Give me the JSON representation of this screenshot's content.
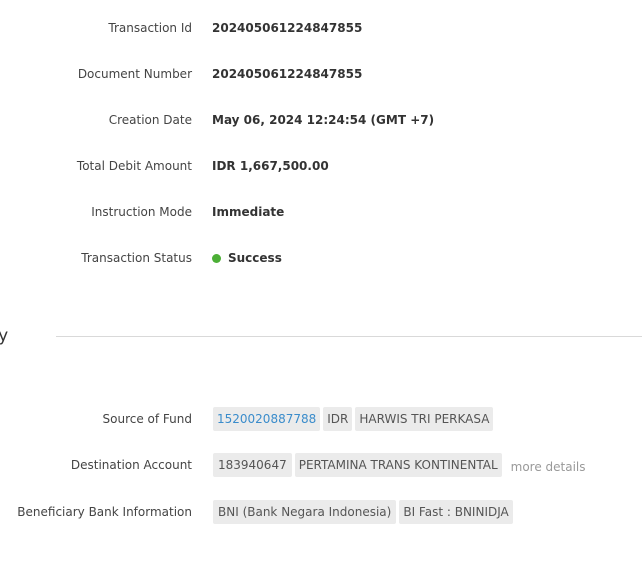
{
  "details": {
    "transaction_id_label": "Transaction Id",
    "transaction_id_value": "202405061224847855",
    "document_number_label": "Document Number",
    "document_number_value": "202405061224847855",
    "creation_date_label": "Creation Date",
    "creation_date_value": "May 06, 2024 12:24:54 (GMT +7)",
    "total_debit_label": "Total Debit Amount",
    "total_debit_value": "IDR 1,667,500.00",
    "instruction_mode_label": "Instruction Mode",
    "instruction_mode_value": "Immediate",
    "transaction_status_label": "Transaction Status",
    "transaction_status_value": "Success",
    "status_color": "#4caf36"
  },
  "summary": {
    "section_title": "nary",
    "source_of_fund": {
      "label": "Source of Fund",
      "account": "1520020887788",
      "currency": "IDR",
      "name": "HARWIS TRI PERKASA"
    },
    "destination_account": {
      "label": "Destination Account",
      "account": "183940647",
      "name": "PERTAMINA TRANS KONTINENTAL",
      "more_details": "more details"
    },
    "beneficiary_bank": {
      "label": "Beneficiary Bank Information",
      "bank": "BNI (Bank Negara Indonesia)",
      "method": "BI Fast : BNINIDJA"
    }
  },
  "colors": {
    "link": "#3a8ccb",
    "chip_bg": "#ebebeb",
    "status_success": "#4caf36"
  }
}
